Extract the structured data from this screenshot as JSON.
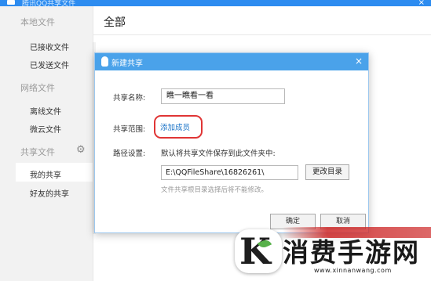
{
  "app": {
    "title": "腾讯QQ共享文件",
    "title_icon": "app-icon"
  },
  "sidebar": {
    "groups": [
      {
        "label": "本地文件",
        "items": [
          "已接收文件",
          "已发送文件"
        ]
      },
      {
        "label": "网络文件",
        "items": [
          "离线文件",
          "微云文件"
        ]
      },
      {
        "label": "共享文件",
        "items": [
          "我的共享",
          "好友的共享"
        ],
        "icon": "gear-icon"
      }
    ],
    "active_item": "我的共享"
  },
  "main": {
    "title": "全部"
  },
  "dialog": {
    "title": "新建共享",
    "title_icon": "penguin-icon",
    "close": "×",
    "name_label": "共享名称:",
    "name_value": "瞧一瞧看一看",
    "range_label": "共享范围:",
    "add_member": "添加成员",
    "path_label": "路径设置:",
    "path_desc": "默认将共享文件保存到此文件夹中:",
    "path_value": "E:\\QQFileShare\\16826261\\",
    "change_dir": "更改目录",
    "hint": "文件共享根目录选择后将不能修改。",
    "ok": "确定",
    "cancel": "取消"
  },
  "watermark": {
    "text": "消费手游网",
    "url": "www.xinnanwang.com"
  },
  "colors": {
    "accent": "#2d8cf0",
    "dialog_header": "#4aa2ea",
    "highlight_ring": "#e03535",
    "link": "#1a73c7"
  }
}
